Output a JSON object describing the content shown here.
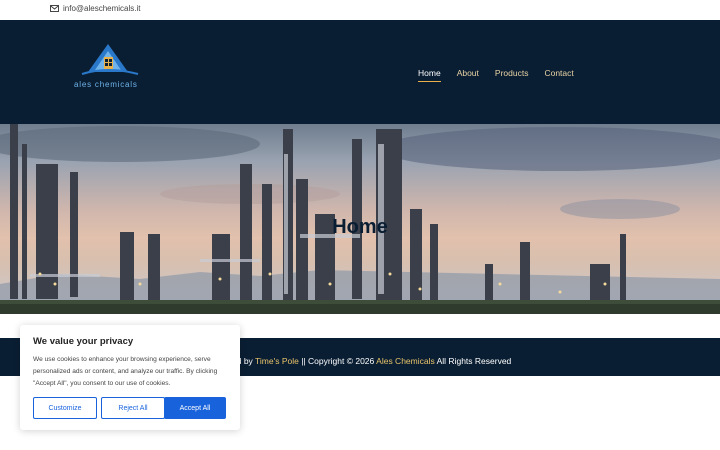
{
  "topbar": {
    "email": "info@aleschemicals.it",
    "email_icon": "mail-icon"
  },
  "header": {
    "brand": "ales chemicals",
    "nav": [
      {
        "label": "Home",
        "active": true
      },
      {
        "label": "About",
        "active": false
      },
      {
        "label": "Products",
        "active": false
      },
      {
        "label": "Contact",
        "active": false
      }
    ]
  },
  "hero": {
    "title": "Home"
  },
  "footer": {
    "prefix": "ed by ",
    "designer": "Time's Pole",
    "middle": " || Copyright © 2026 ",
    "company": "Ales Chemicals",
    "suffix": " All Rights Reserved"
  },
  "cookie": {
    "heading": "We value your privacy",
    "body": "We use cookies to enhance your browsing experience, serve personalized ads or content, and analyze our traffic. By clicking \"Accept All\", you consent to our use of cookies.",
    "buttons": {
      "customize": "Customize",
      "reject": "Reject All",
      "accept": "Accept All"
    }
  },
  "colors": {
    "header_bg": "#0a1e33",
    "accent_blue": "#1863dc",
    "nav_gold": "#e9d3a4",
    "brand_blue": "#6fb3ea"
  }
}
